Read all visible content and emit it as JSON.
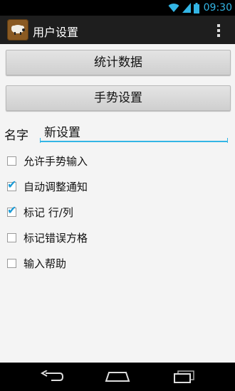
{
  "status_bar": {
    "time": "09:30",
    "icons": [
      "wifi-icon",
      "signal-icon",
      "battery-icon"
    ],
    "accent_color": "#33b5e5"
  },
  "action_bar": {
    "title": "用户设置",
    "app_icon": "app-logo-icon",
    "menu_icon": "overflow-menu-icon"
  },
  "buttons": {
    "stats_label": "统计数据",
    "gesture_label": "手势设置"
  },
  "name_field": {
    "label": "名字",
    "value": "新设置"
  },
  "options": [
    {
      "label": "允许手势输入",
      "checked": false
    },
    {
      "label": "自动调整通知",
      "checked": true
    },
    {
      "label": "标记 行/列",
      "checked": true
    },
    {
      "label": "标记错误方格",
      "checked": false
    },
    {
      "label": "输入帮助",
      "checked": false
    }
  ],
  "nav_bar": {
    "icons": [
      "back-icon",
      "home-icon",
      "recent-apps-icon"
    ]
  }
}
